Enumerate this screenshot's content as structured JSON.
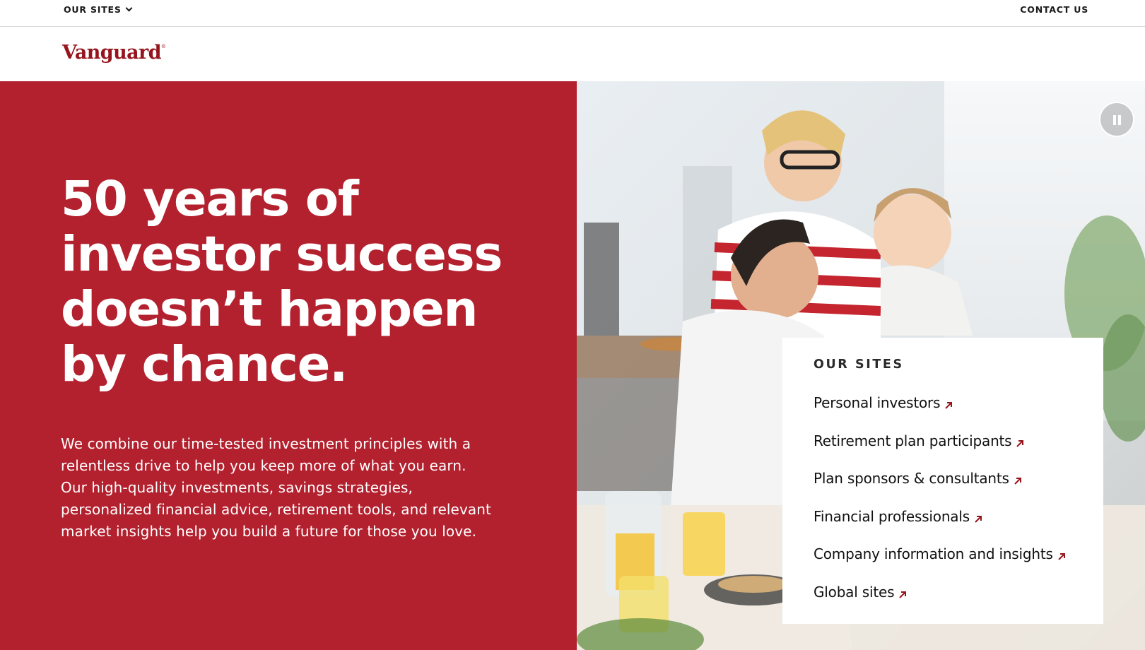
{
  "utility_bar": {
    "our_sites_label": "OUR SITES",
    "contact_label": "CONTACT US"
  },
  "header": {
    "logo_text": "Vanguard",
    "logo_mark": "®",
    "brand_color": "#96151d"
  },
  "hero": {
    "background_color": "#b3202e",
    "title_lines": [
      "50 years of",
      "investor success",
      "doesn’t happen",
      "by chance."
    ],
    "body": "We combine our time-tested investment principles with a relentless drive to help you keep more of what you earn. Our high-quality investments, savings strategies, personalized financial advice, retirement tools, and relevant market insights help you build a future for those you love.",
    "pause_icon": "pause-icon"
  },
  "sites_card": {
    "heading": "OUR SITES",
    "arrow_color": "#96151d",
    "links": [
      {
        "label": "Personal investors"
      },
      {
        "label": "Retirement plan participants"
      },
      {
        "label": "Plan sponsors & consultants"
      },
      {
        "label": "Financial professionals"
      },
      {
        "label": "Company information and insights"
      },
      {
        "label": "Global sites"
      }
    ]
  }
}
